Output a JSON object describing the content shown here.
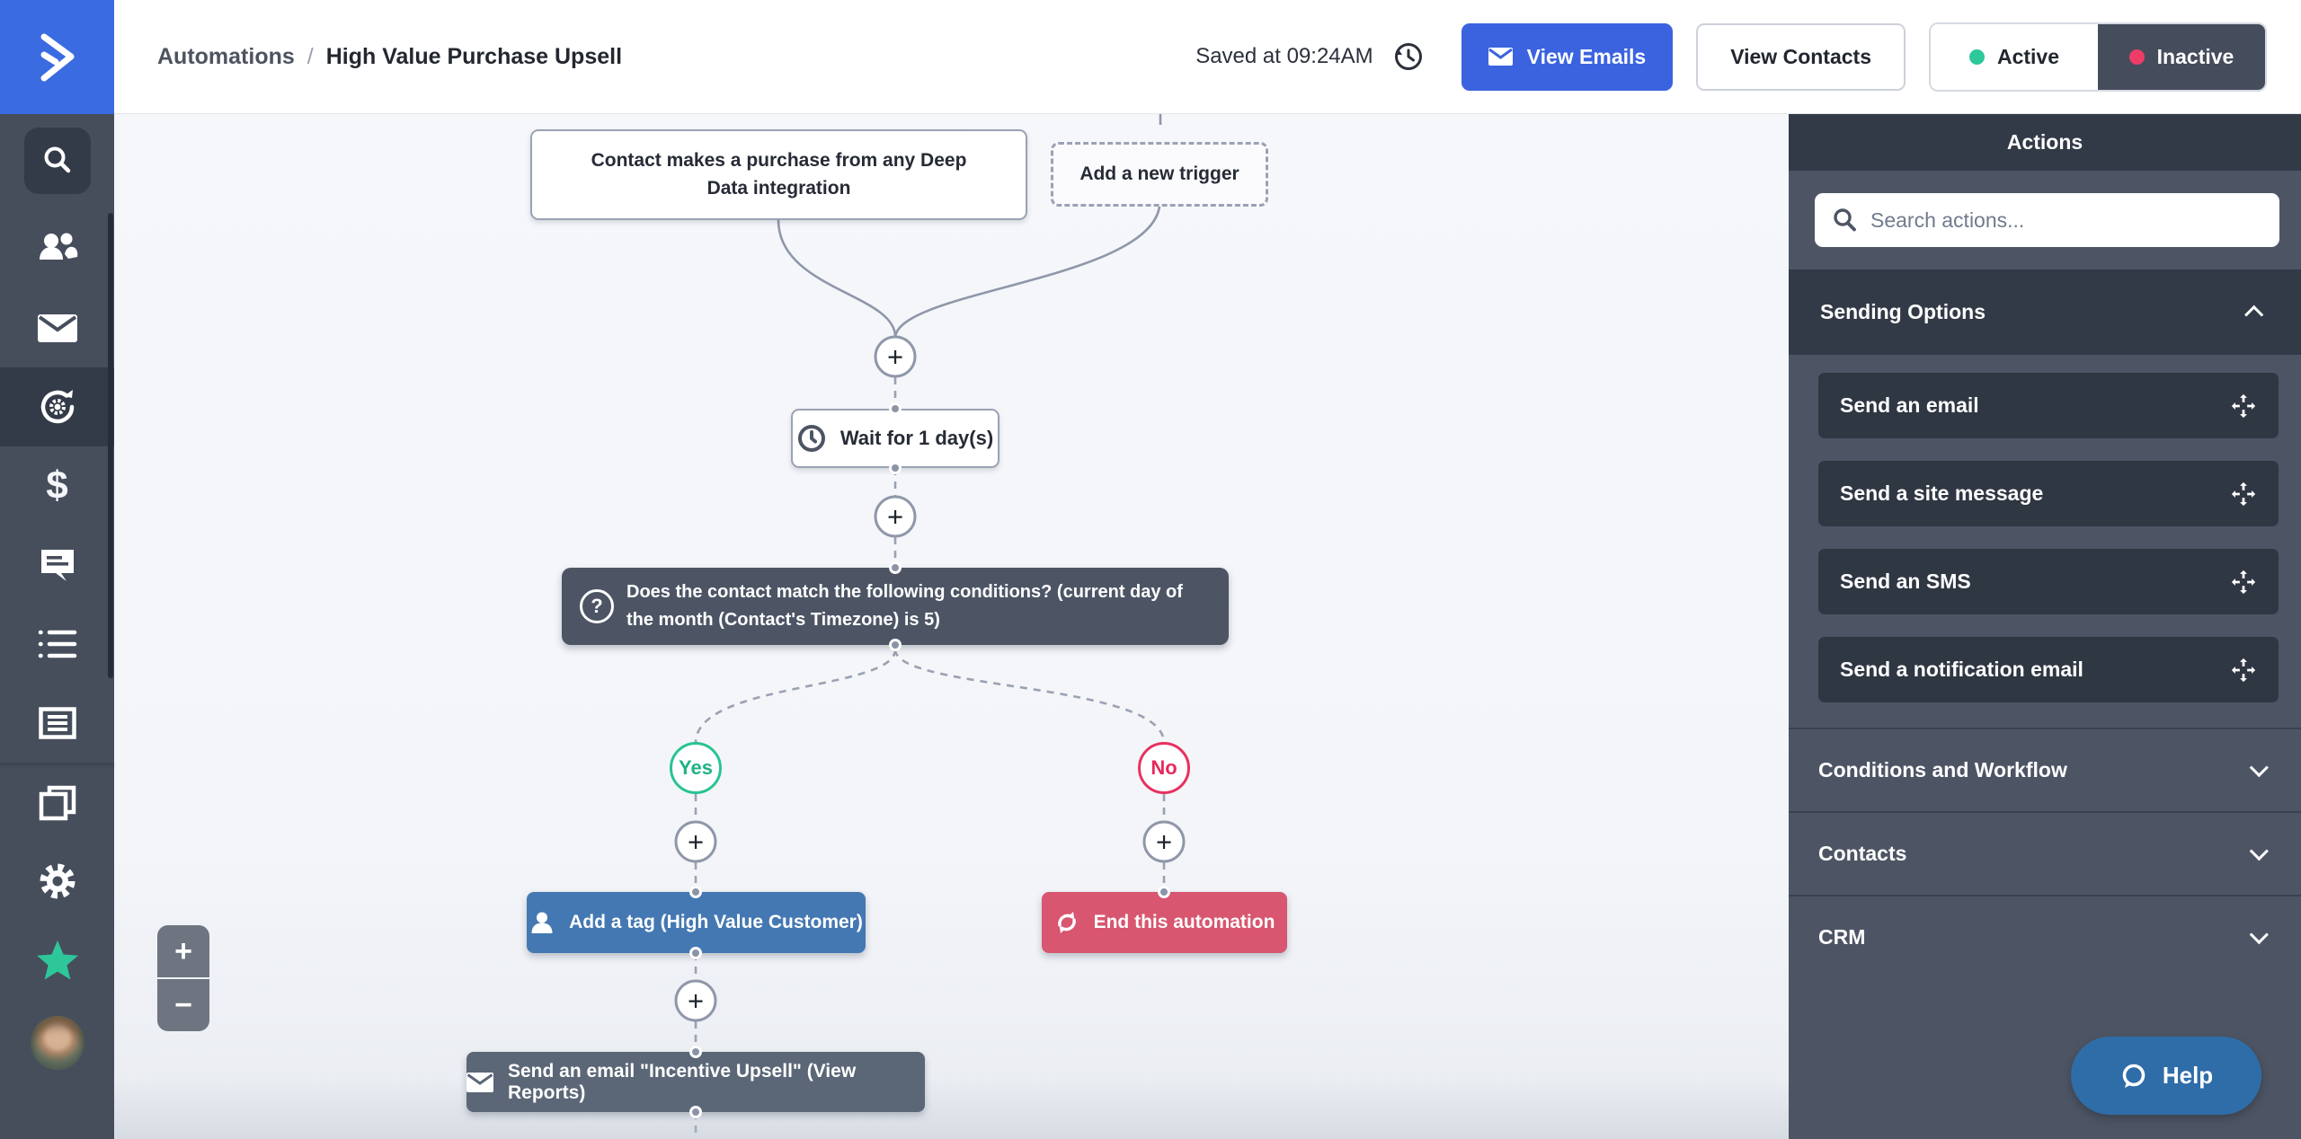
{
  "topbar": {
    "breadcrumb": {
      "section": "Automations",
      "separator": "/",
      "title": "High Value Purchase Upsell"
    },
    "saved_status": "Saved at 09:24AM",
    "view_emails_label": "View Emails",
    "view_contacts_label": "View Contacts",
    "toggle": {
      "active_label": "Active",
      "inactive_label": "Inactive",
      "selected": "Inactive",
      "active_dot_color": "#2ec79a",
      "inactive_dot_color": "#ee3c68"
    }
  },
  "sidebar": {
    "items": [
      "search",
      "contacts",
      "campaigns",
      "automations-active",
      "deals",
      "conversations",
      "lists",
      "forms",
      "sites",
      "settings",
      "reviews",
      "account-avatar"
    ],
    "deals_glyph": "$",
    "reviews_star_color": "#2ec79a",
    "brand_color": "#3a6be0"
  },
  "canvas": {
    "nodes": {
      "trigger": "Contact makes a purchase from any Deep Data integration",
      "add_trigger": "Add a new trigger",
      "wait": "Wait for 1 day(s)",
      "condition": "Does the contact match the following conditions? (current day of the month (Contact's Timezone) is 5)",
      "yes_label": "Yes",
      "no_label": "No",
      "add_tag": "Add a tag (High Value Customer)",
      "end_automation": "End this automation",
      "send_email": "Send an email \"Incentive Upsell\" (View Reports)"
    },
    "plus_glyph": "+",
    "condition_icon_glyph": "?",
    "zoom": {
      "in": "+",
      "out": "−"
    },
    "colors": {
      "yes_green": "#29c395",
      "no_red": "#e73260",
      "tag_blue": "#4478b2",
      "end_pink": "#d8566f",
      "email_slate": "#5b6777",
      "condition_slate": "#4d5565"
    }
  },
  "actions_panel": {
    "title": "Actions",
    "search_placeholder": "Search actions...",
    "sections": [
      {
        "label": "Sending Options",
        "expanded": true,
        "items": [
          "Send an email",
          "Send a site message",
          "Send an SMS",
          "Send a notification email"
        ]
      },
      {
        "label": "Conditions and Workflow",
        "expanded": false
      },
      {
        "label": "Contacts",
        "expanded": false
      },
      {
        "label": "CRM",
        "expanded": false
      }
    ],
    "help_label": "Help",
    "help_color": "#2f6da8"
  }
}
